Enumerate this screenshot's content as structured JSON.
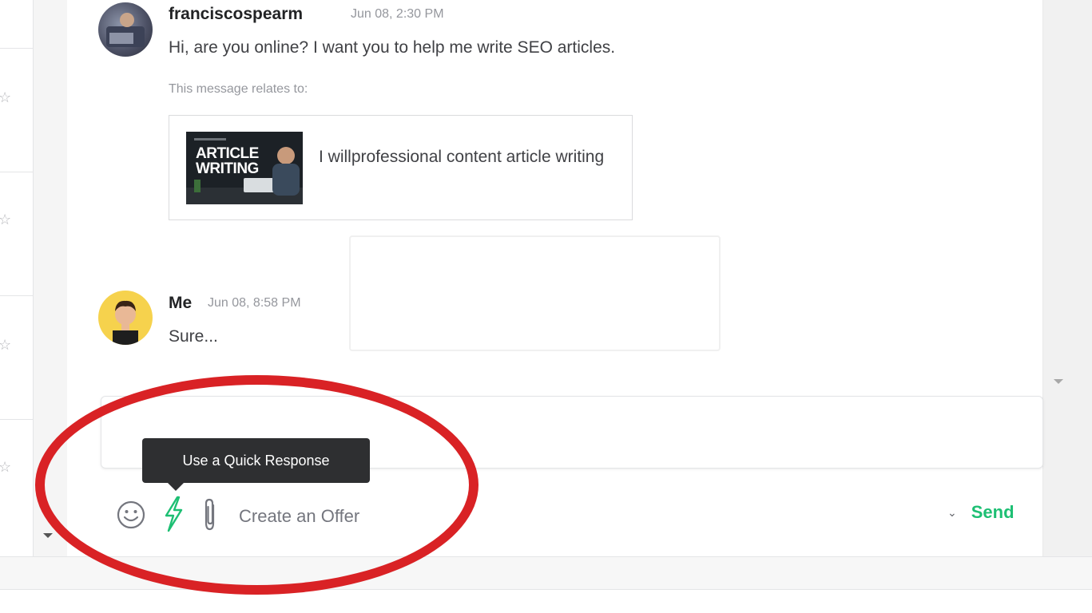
{
  "messages": [
    {
      "sender": "franciscospearm",
      "time": "Jun 08, 2:30 PM",
      "text": "Hi, are you online? I want you to help me write SEO articles."
    },
    {
      "sender": "Me",
      "time": "Jun 08, 8:58 PM",
      "text": "Sure..."
    }
  ],
  "relates": {
    "label": "This message relates to:",
    "gig_title": "I willprofessional content article writing",
    "thumb_lines": [
      "ARTICLE",
      "WRITING"
    ]
  },
  "composer": {
    "value": "",
    "tooltip": "Use a Quick Response",
    "create_offer": "Create an Offer",
    "send": "Send"
  },
  "icons": {
    "emoji": "smiley-icon",
    "quick": "lightning-icon",
    "attach": "paperclip-icon",
    "chevron": "chevron-down-icon",
    "star": "star-icon"
  },
  "colors": {
    "brand_green": "#1dbf73",
    "highlight_red": "#d92225",
    "tooltip_bg": "#2e2f31"
  }
}
